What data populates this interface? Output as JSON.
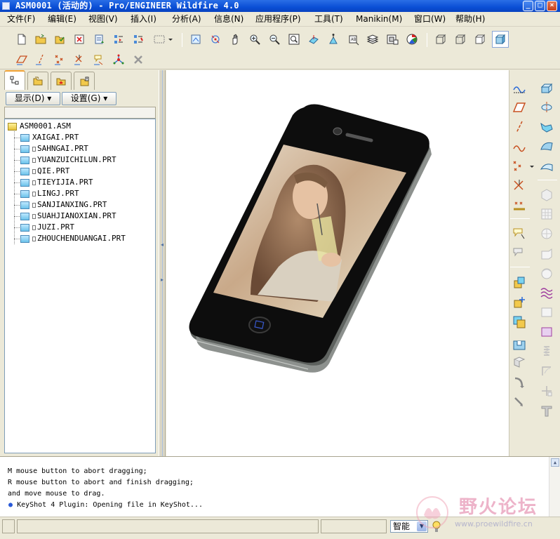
{
  "window": {
    "title": "ASM0001 (活动的) - Pro/ENGINEER Wildfire 4.0"
  },
  "menu": [
    "文件(F)",
    "编辑(E)",
    "视图(V)",
    "插入(I)",
    "分析(A)",
    "信息(N)",
    "应用程序(P)",
    "工具(T)",
    "Manikin(M)",
    "窗口(W)",
    "帮助(H)"
  ],
  "navigator": {
    "show_button": "显示(D)",
    "settings_button": "设置(G)",
    "tree": {
      "root": "ASM0001.ASM",
      "items": [
        "XAIGAI.PRT",
        "SAHNGAI.PRT",
        "YUANZUICHILUN.PRT",
        "QIE.PRT",
        "TIEYIJIA.PRT",
        "LINGJ.PRT",
        "SANJIANXING.PRT",
        "SUAHJIANOXIAN.PRT",
        "JUZI.PRT",
        "ZHOUCHENDUANGAI.PRT"
      ]
    }
  },
  "messages": [
    "M mouse button to abort dragging;",
    "R mouse button to abort and finish dragging;",
    "and move mouse to drag.",
    "KeyShot 4 Plugin: Opening file in KeyShot..."
  ],
  "status": {
    "filter_value": "智能"
  },
  "watermark": {
    "text": "野火论坛",
    "url": "www.proewildfire.cn"
  },
  "colors": {
    "title_blue": "#0a4fd6",
    "chrome": "#ece9d8",
    "tree_border": "#7f9db9"
  }
}
